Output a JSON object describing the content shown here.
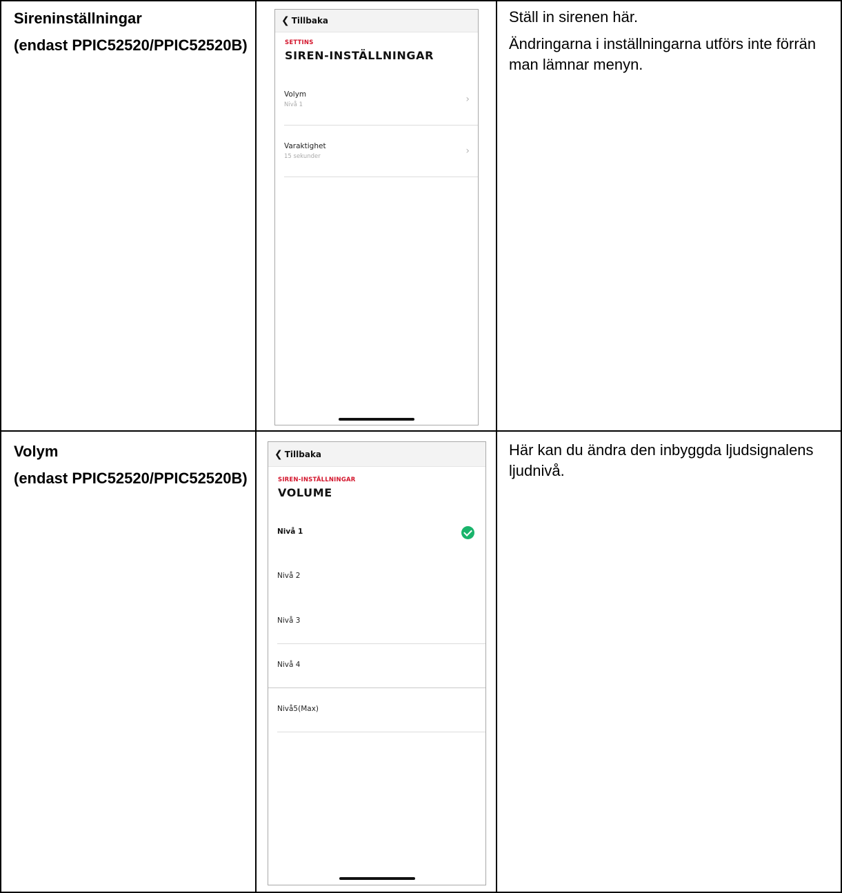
{
  "rows": [
    {
      "feature_title": "Sireninställningar",
      "feature_note": "(endast PPIC52520/PPIC52520B)",
      "description": [
        "Ställ in sirenen här.",
        "Ändringarna i inställningarna utförs inte förrän man lämnar menyn."
      ],
      "screen": {
        "back_label": "Tillbaka",
        "crumb": "SETTINS",
        "title": "SIREN-INSTÄLLNINGAR",
        "items": [
          {
            "label": "Volym",
            "value": "Nivå 1"
          },
          {
            "label": "Varaktighet",
            "value": "15 sekunder"
          }
        ]
      }
    },
    {
      "feature_title": "Volym",
      "feature_note": "(endast PPIC52520/PPIC52520B)",
      "description": [
        "Här kan du ändra den inbyggda ljudsignalens ljudnivå."
      ],
      "screen": {
        "back_label": "Tillbaka",
        "crumb": "SIREN-INSTÄLLNINGAR",
        "title": "VOLUME",
        "options": [
          "Nivå 1",
          "Nivå 2",
          "Nivå 3",
          "Nivå 4",
          "Nivå5(Max)"
        ],
        "selected": "Nivå 1"
      }
    }
  ],
  "icons": {
    "back": "chevron-left-icon",
    "row_arrow": "chevron-right-icon",
    "selected": "checkmark-circle-icon"
  },
  "colors": {
    "accent": "#d3142b",
    "check": "#19b46b"
  }
}
